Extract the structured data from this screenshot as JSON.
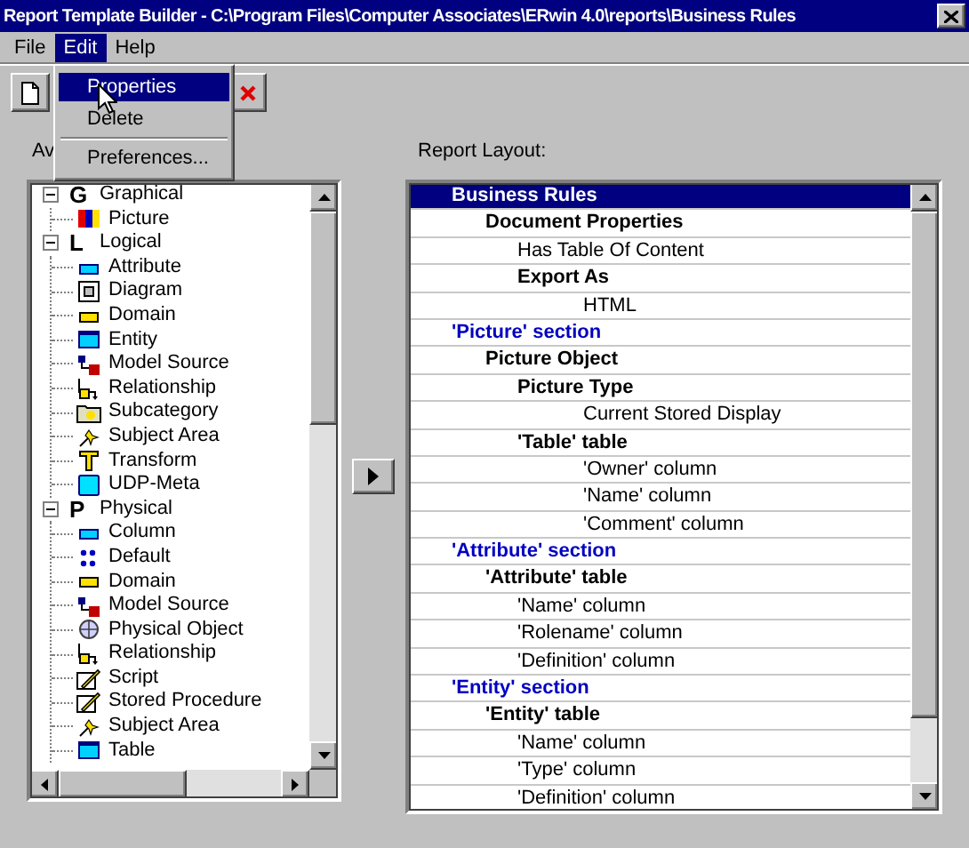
{
  "window": {
    "title": "Report Template Builder - C:\\Program Files\\Computer Associates\\ERwin 4.0\\reports\\Business Rules"
  },
  "menu_bar": [
    {
      "label": "File",
      "selected": false
    },
    {
      "label": "Edit",
      "selected": true
    },
    {
      "label": "Help",
      "selected": false
    }
  ],
  "edit_menu": [
    {
      "label": "Properties",
      "selected": true,
      "separator_before": false
    },
    {
      "label": "Delete",
      "selected": false,
      "separator_before": false
    },
    {
      "label": "Preferences...",
      "selected": false,
      "separator_before": true
    }
  ],
  "toolbar": [
    {
      "kind": "new"
    },
    {
      "kind": "delete"
    }
  ],
  "available_panel": {
    "label": "Av",
    "tree": [
      {
        "letter": "G",
        "label": "Graphical",
        "expanded": true,
        "children": [
          {
            "label": "Picture",
            "kind": "picture"
          }
        ]
      },
      {
        "letter": "L",
        "label": "Logical",
        "expanded": true,
        "children": [
          {
            "label": "Attribute",
            "kind": "attribute"
          },
          {
            "label": "Diagram",
            "kind": "diagram"
          },
          {
            "label": "Domain",
            "kind": "domain"
          },
          {
            "label": "Entity",
            "kind": "entity"
          },
          {
            "label": "Model Source",
            "kind": "model-source"
          },
          {
            "label": "Relationship",
            "kind": "relationship"
          },
          {
            "label": "Subcategory",
            "kind": "subcategory"
          },
          {
            "label": "Subject Area",
            "kind": "subject-area"
          },
          {
            "label": "Transform",
            "kind": "transform"
          },
          {
            "label": "UDP-Meta",
            "kind": "udp-meta"
          }
        ]
      },
      {
        "letter": "P",
        "label": "Physical",
        "expanded": true,
        "children": [
          {
            "label": "Column",
            "kind": "attribute"
          },
          {
            "label": "Default",
            "kind": "default"
          },
          {
            "label": "Domain",
            "kind": "domain"
          },
          {
            "label": "Model Source",
            "kind": "model-source"
          },
          {
            "label": "Physical Object",
            "kind": "physical-object"
          },
          {
            "label": "Relationship",
            "kind": "relationship"
          },
          {
            "label": "Script",
            "kind": "script"
          },
          {
            "label": "Stored Procedure",
            "kind": "script"
          },
          {
            "label": "Subject Area",
            "kind": "subject-area"
          },
          {
            "label": "Table",
            "kind": "entity"
          }
        ]
      }
    ]
  },
  "layout_panel": {
    "label": "Report Layout:",
    "rows": [
      {
        "label": "Business Rules",
        "kind": "heading",
        "selected": true,
        "children": [
          {
            "label": "Document Properties",
            "kind": "heading",
            "selected": false,
            "children": [
              {
                "label": "Has Table Of Content",
                "kind": "value",
                "selected": false
              },
              {
                "label": "Export As",
                "kind": "heading",
                "selected": false,
                "children": [
                  {
                    "label": "HTML",
                    "kind": "value",
                    "selected": false
                  }
                ]
              }
            ]
          }
        ]
      },
      {
        "label": "'Picture' section",
        "kind": "section",
        "selected": false,
        "children": [
          {
            "label": "Picture Object",
            "kind": "heading",
            "selected": false,
            "children": [
              {
                "label": "Picture Type",
                "kind": "heading",
                "selected": false,
                "children": [
                  {
                    "label": "Current Stored Display",
                    "kind": "value",
                    "selected": false
                  }
                ]
              },
              {
                "label": "'Table' table",
                "kind": "heading",
                "selected": false,
                "children": [
                  {
                    "label": "'Owner' column",
                    "kind": "value",
                    "selected": false
                  },
                  {
                    "label": "'Name' column",
                    "kind": "value",
                    "selected": false
                  },
                  {
                    "label": "'Comment' column",
                    "kind": "value",
                    "selected": false
                  }
                ]
              }
            ]
          }
        ]
      },
      {
        "label": "'Attribute' section",
        "kind": "section",
        "selected": false,
        "children": [
          {
            "label": "'Attribute' table",
            "kind": "heading",
            "selected": false,
            "children": [
              {
                "label": "'Name' column",
                "kind": "value",
                "selected": false
              },
              {
                "label": "'Rolename' column",
                "kind": "value",
                "selected": false
              },
              {
                "label": "'Definition' column",
                "kind": "value",
                "selected": false
              }
            ]
          }
        ]
      },
      {
        "label": "'Entity' section",
        "kind": "section",
        "selected": false,
        "children": [
          {
            "label": "'Entity' table",
            "kind": "heading",
            "selected": false,
            "children": [
              {
                "label": "'Name' column",
                "kind": "value",
                "selected": false
              },
              {
                "label": "'Type' column",
                "kind": "value",
                "selected": false
              },
              {
                "label": "'Definition' column",
                "kind": "value",
                "selected": false
              }
            ]
          }
        ]
      }
    ]
  }
}
